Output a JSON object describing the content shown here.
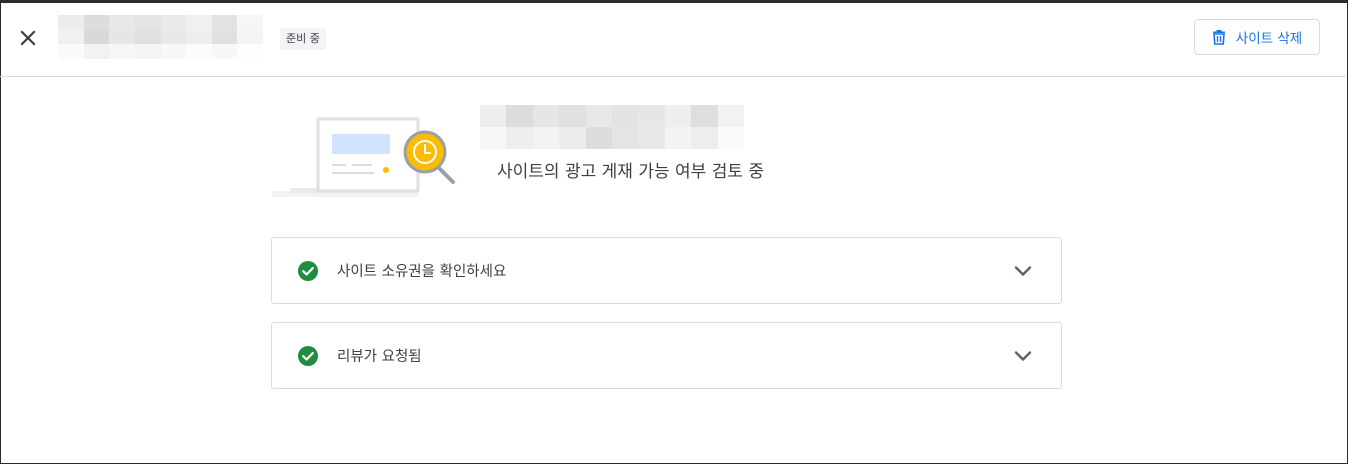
{
  "header": {
    "status_chip": "준비 중",
    "delete_label": "사이트 삭제"
  },
  "hero": {
    "subtitle": "사이트의 광고 게재 가능 여부 검토 중"
  },
  "steps": [
    {
      "label": "사이트 소유권을 확인하세요",
      "status": "complete"
    },
    {
      "label": "리뷰가 요청됨",
      "status": "complete"
    }
  ],
  "colors": {
    "accent": "#1a73e8",
    "success": "#1e8e3e",
    "clock": "#fbbc04"
  }
}
